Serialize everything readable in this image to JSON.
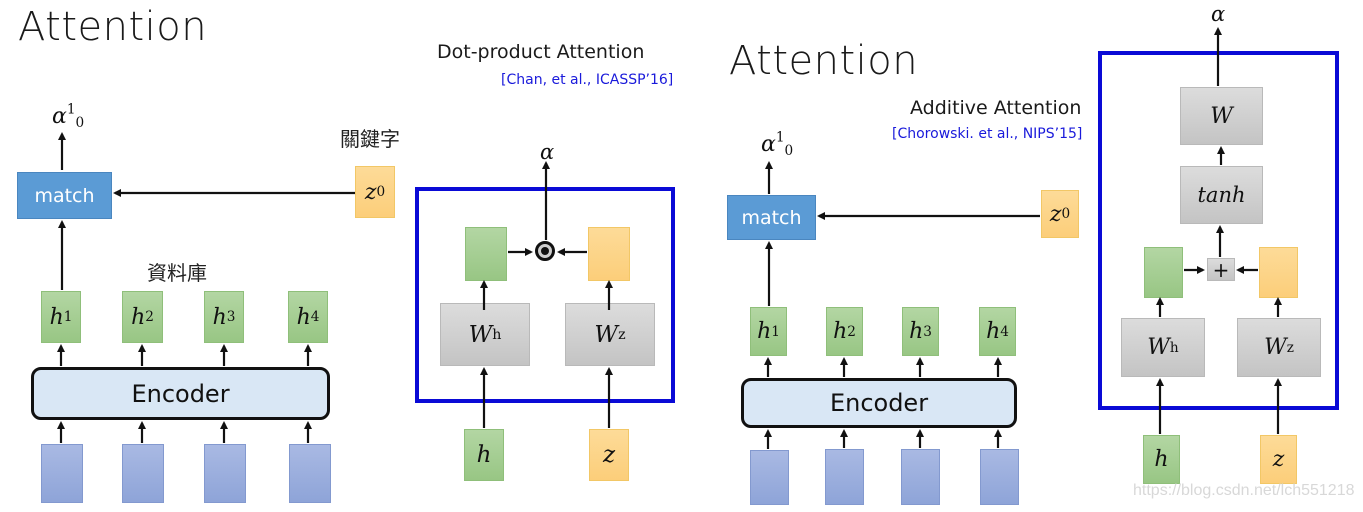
{
  "left_slide": {
    "title": "Attention",
    "keyword_label": "關鍵字",
    "database_label": "資料庫",
    "match_label": "match",
    "alpha_output": {
      "base": "α",
      "sub": "0",
      "sup": "1"
    },
    "query": {
      "base": "z",
      "sup": "0"
    },
    "hidden_states": [
      {
        "base": "h",
        "sup": "1"
      },
      {
        "base": "h",
        "sup": "2"
      },
      {
        "base": "h",
        "sup": "3"
      },
      {
        "base": "h",
        "sup": "4"
      }
    ],
    "encoder_label": "Encoder",
    "input_count": 4
  },
  "dot_product": {
    "title": "Dot-product Attention",
    "citation": "[Chan, et al., ICASSP’16]",
    "output": "α",
    "operator": "⊙",
    "weight_h": {
      "base": "W",
      "sup": "h"
    },
    "weight_z": {
      "base": "W",
      "sup": "z"
    },
    "input_h": "h",
    "input_z": "z"
  },
  "right_slide": {
    "title": "Attention",
    "match_label": "match",
    "alpha_output": {
      "base": "α",
      "sub": "0",
      "sup": "1"
    },
    "query": {
      "base": "z",
      "sup": "0"
    },
    "hidden_states": [
      {
        "base": "h",
        "sup": "1"
      },
      {
        "base": "h",
        "sup": "2"
      },
      {
        "base": "h",
        "sup": "3"
      },
      {
        "base": "h",
        "sup": "4"
      }
    ],
    "encoder_label": "Encoder",
    "input_count": 4
  },
  "additive": {
    "title": "Additive Attention",
    "citation": "[Chorowski. et al., NIPS’15]",
    "output": "α",
    "weight": "W",
    "activation": "tanh",
    "operator": "+",
    "weight_h": {
      "base": "W",
      "sup": "h"
    },
    "weight_z": {
      "base": "W",
      "sup": "z"
    },
    "input_h": "h",
    "input_z": "z"
  },
  "watermark": "https://blog.csdn.net/lch551218",
  "colors": {
    "match_blue": "#5b9bd5",
    "hidden_green": "#a6cf93",
    "query_yellow": "#fcd48a",
    "input_blue": "#9bafdd",
    "weight_gray": "#d0d0d0",
    "frame_blue": "#0a0ad6",
    "citation_blue": "#1a1adb"
  }
}
